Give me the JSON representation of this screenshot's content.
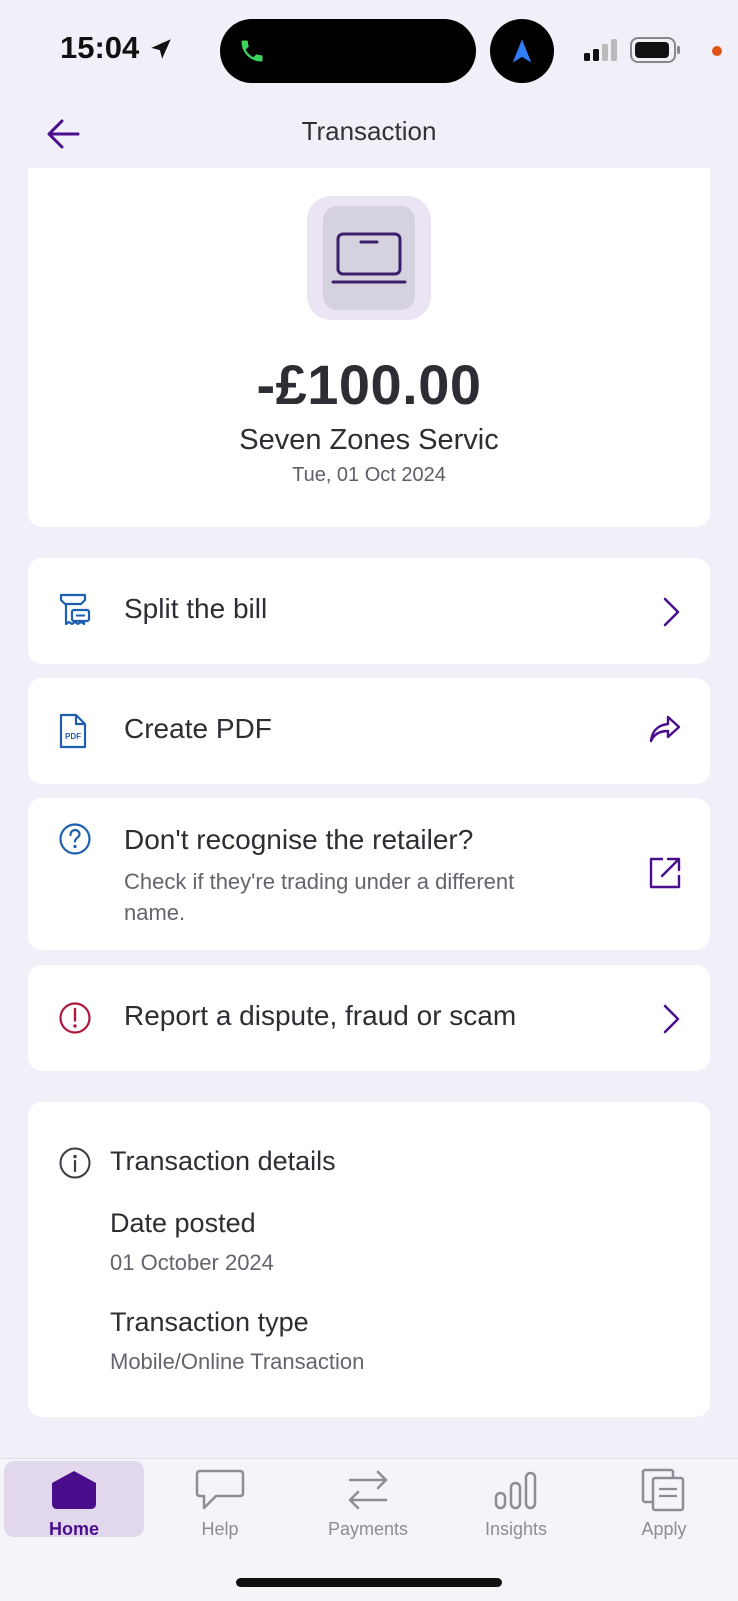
{
  "status_bar": {
    "time": "15:04",
    "icons": [
      "location-arrow-icon",
      "phone-icon",
      "navigation-icon",
      "signal-icon",
      "battery-icon"
    ]
  },
  "header": {
    "title": "Transaction",
    "back_icon": "arrow-left-icon"
  },
  "transaction": {
    "amount": "-£100.00",
    "merchant": "Seven Zones Servic",
    "date": "Tue, 01 Oct 2024",
    "category_icon": "laptop-icon"
  },
  "actions": [
    {
      "label": "Split the bill",
      "icon": "receipt-icon",
      "trailing_icon": "chevron-right-icon"
    },
    {
      "label": "Create PDF",
      "icon": "pdf-icon",
      "icon_text": "PDF",
      "trailing_icon": "share-icon"
    },
    {
      "label": "Don't recognise the retailer?",
      "subtitle": "Check if they're trading under a different name.",
      "icon": "question-icon",
      "trailing_icon": "external-link-icon"
    },
    {
      "label": "Report a dispute, fraud or scam",
      "icon": "alert-icon",
      "trailing_icon": "chevron-right-icon"
    }
  ],
  "details": {
    "title": "Transaction details",
    "icon": "info-icon",
    "items": [
      {
        "label": "Date posted",
        "value": "01 October 2024"
      },
      {
        "label": "Transaction type",
        "value": "Mobile/Online Transaction"
      }
    ]
  },
  "tab_bar": {
    "active": "Home",
    "tabs": [
      {
        "label": "Home",
        "icon": "home-icon"
      },
      {
        "label": "Help",
        "icon": "chat-bubble-icon"
      },
      {
        "label": "Payments",
        "icon": "transfer-arrows-icon"
      },
      {
        "label": "Insights",
        "icon": "bar-chart-icon"
      },
      {
        "label": "Apply",
        "icon": "documents-icon"
      }
    ]
  },
  "colors": {
    "background": "#f1eff7",
    "card": "#ffffff",
    "accent": "#4a0e8c",
    "icon_blue": "#1e5fb0",
    "alert_red": "#b0173d",
    "text_dark": "#2d2d33",
    "text_muted": "#66636d"
  }
}
